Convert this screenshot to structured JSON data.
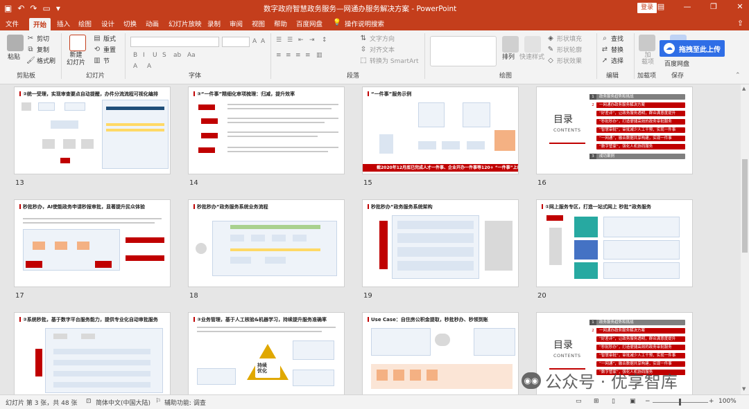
{
  "titlebar": {
    "title": "数字政府智慧政务服务—网通办服务解决方案 - PowerPoint",
    "login_label": "登录",
    "qat_icons": [
      "save-icon",
      "undo-icon",
      "redo-icon",
      "present-icon",
      "customize-icon"
    ],
    "window_icons": [
      "ribbon-display-icon",
      "minimize-icon",
      "restore-icon",
      "close-icon"
    ]
  },
  "tabs": {
    "items": [
      "文件",
      "开始",
      "插入",
      "绘图",
      "设计",
      "切换",
      "动画",
      "幻灯片放映",
      "录制",
      "审阅",
      "视图",
      "帮助",
      "百度网盘",
      "操作说明搜索"
    ],
    "active": "开始",
    "search_icon": "lightbulb-icon"
  },
  "ribbon": {
    "clipboard": {
      "paste": "粘贴",
      "cut": "剪切",
      "copy": "复制",
      "format_painter": "格式刷",
      "label": "剪贴板"
    },
    "slides": {
      "new_slide": "新建\n幻灯片",
      "layout": "版式",
      "reset": "重置",
      "section": "节",
      "label": "幻灯片"
    },
    "font": {
      "label": "字体",
      "font_name": "",
      "font_size": ""
    },
    "paragraph": {
      "text_direction": "文字方向",
      "align_text": "对齐文本",
      "smartart": "转换为 SmartArt",
      "label": "段落"
    },
    "drawing": {
      "arrange": "排列",
      "quick_styles": "快速样式",
      "shape_fill": "形状填充",
      "shape_outline": "形状轮廓",
      "shape_effects": "形状效果",
      "label": "绘图"
    },
    "editing": {
      "find": "查找",
      "replace": "替换",
      "select": "选择",
      "label": "编辑"
    },
    "addins": {
      "addins": "加\n载项",
      "label": "加载项"
    },
    "baidu": {
      "save_to": "百度网盘",
      "label": "保存",
      "upload": "拖拽至此上传"
    }
  },
  "slides": [
    {
      "num": "13",
      "title": "②统一受理，实现审查要点自动提醒，办件分流流程可视化编排"
    },
    {
      "num": "14",
      "title": "③“一件事”精细化审项梳理：归减，提升效率"
    },
    {
      "num": "15",
      "title": "“一件事”服务示例",
      "banner": "截2020年12月底已完成人才一件事、企业开办一件事等120+ “一件事”上线"
    },
    {
      "num": "16",
      "toc_title": "目录",
      "toc_sub": "CONTENTS",
      "toc_items": [
        {
          "n": "1",
          "t": "政务服务趋势和挑战",
          "style": "g"
        },
        {
          "n": "2",
          "t": "一网通办政务服务解决方案",
          "style": "r"
        },
        {
          "n": "",
          "t": "“好差评”，让政务服务透明，群众满意度提升",
          "style": "pr"
        },
        {
          "n": "",
          "t": "“秒批秒办”，打造便捷高效的政务审批服务",
          "style": "pr"
        },
        {
          "n": "",
          "t": "“智慧审批”，审批减少人工干预，实现一件事",
          "style": "pr"
        },
        {
          "n": "",
          "t": "“一网通”，融合数据共享构建，实现一件事",
          "style": "pr"
        },
        {
          "n": "",
          "t": "“数字管家”，强化人机协同服务",
          "style": "pr"
        },
        {
          "n": "3",
          "t": "成功案例",
          "style": "g"
        }
      ]
    },
    {
      "num": "17",
      "title": "秒批秒办，AI使能政务申请秒报审批，显著提升民众体验"
    },
    {
      "num": "18",
      "title": "秒批秒办“政务服务系统业务流程"
    },
    {
      "num": "19",
      "title": "秒批秒办“政务服务系统架构"
    },
    {
      "num": "20",
      "title": "①网上服务专区，打造一站式网上 秒批”政务服务"
    },
    {
      "num": "",
      "title": "②系统秒批，基于数字平台服务能力，提供专业化自动审批服务"
    },
    {
      "num": "",
      "title": "③业务管理，基于人工核验&机器学习，持续提升服务准确率",
      "triangle_label": "持续\n优化"
    },
    {
      "num": "",
      "title": "Use Case：自住房公积金提取，秒批秒办、秒领到账"
    },
    {
      "num": "",
      "toc_title": "目录",
      "toc_sub": "CONTENTS"
    }
  ],
  "watermark": {
    "text": "公众号 · 优享智库"
  },
  "statusbar": {
    "slide_info": "幻灯片 第 3 张，共 48 张",
    "language": "简体中文(中国大陆)",
    "accessibility": "辅助功能: 调查",
    "zoom": "100%"
  }
}
